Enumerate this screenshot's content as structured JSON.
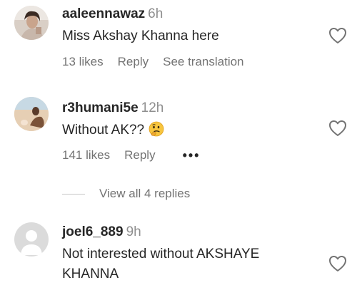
{
  "comments": [
    {
      "username": "aaleennawaz",
      "time": "6h",
      "text": "Miss Akshay Khanna here",
      "likes": "13 likes",
      "reply": "Reply",
      "translation": "See translation"
    },
    {
      "username": "r3humani5e",
      "time": "12h",
      "text": "Without AK??",
      "emoji": "thinking-face-emoji",
      "likes": "141 likes",
      "reply": "Reply",
      "more": "•••"
    },
    {
      "username": "joel6_889",
      "time": "9h",
      "text_line1": "Not interested without AKSHAYE",
      "text_line2": "KHANNA"
    }
  ],
  "view_replies": "View all 4 replies",
  "colors": {
    "text": "#262626",
    "secondary": "#737373",
    "timestamp": "#8e8e8e",
    "divider": "#c7c7c7"
  }
}
